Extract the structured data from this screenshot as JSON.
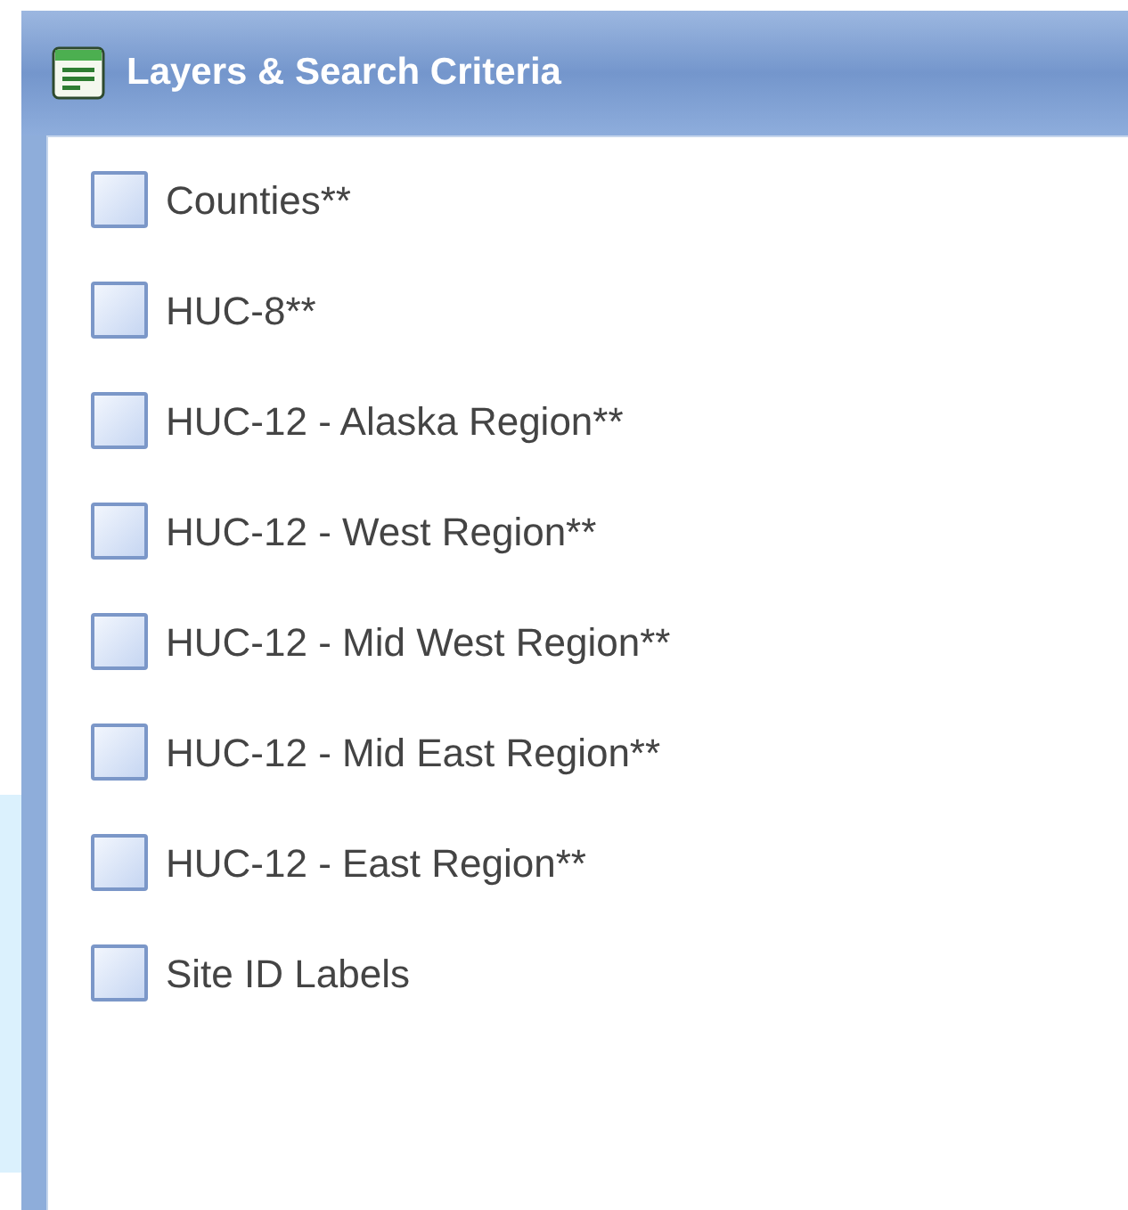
{
  "panel": {
    "title": "Layers & Search Criteria"
  },
  "layers": [
    {
      "label": "Counties**",
      "checked": false
    },
    {
      "label": "HUC-8**",
      "checked": false
    },
    {
      "label": "HUC-12 - Alaska Region**",
      "checked": false
    },
    {
      "label": "HUC-12 - West Region**",
      "checked": false
    },
    {
      "label": "HUC-12 - Mid West Region**",
      "checked": false
    },
    {
      "label": "HUC-12 - Mid East Region**",
      "checked": false
    },
    {
      "label": "HUC-12 - East Region**",
      "checked": false
    },
    {
      "label": "Site ID Labels",
      "checked": false
    }
  ]
}
